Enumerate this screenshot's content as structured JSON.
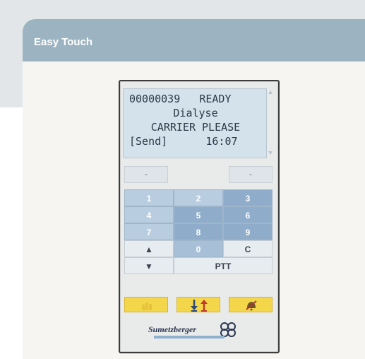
{
  "card": {
    "title": "Easy Touch"
  },
  "screen": {
    "line1": "00000039   READY",
    "line2": "Dialyse",
    "line3": "CARRIER PLEASE",
    "line4": "[Send]      16:07"
  },
  "soft_keys": {
    "left": "-",
    "right": "-"
  },
  "keypad": {
    "k1": "1",
    "k2": "2",
    "k3": "3",
    "k4": "4",
    "k5": "5",
    "k6": "6",
    "k7": "7",
    "k8": "8",
    "k9": "9",
    "up": "▲",
    "k0": "0",
    "clear": "C",
    "down": "▼",
    "ptt": "PTT"
  },
  "logo": {
    "brand": "Sumetzberger"
  },
  "colors": {
    "header": "#9cb4c2",
    "screen_bg": "#d4e2ec",
    "key_blue": "#b9cde0",
    "func_yellow": "#f4d64a"
  }
}
